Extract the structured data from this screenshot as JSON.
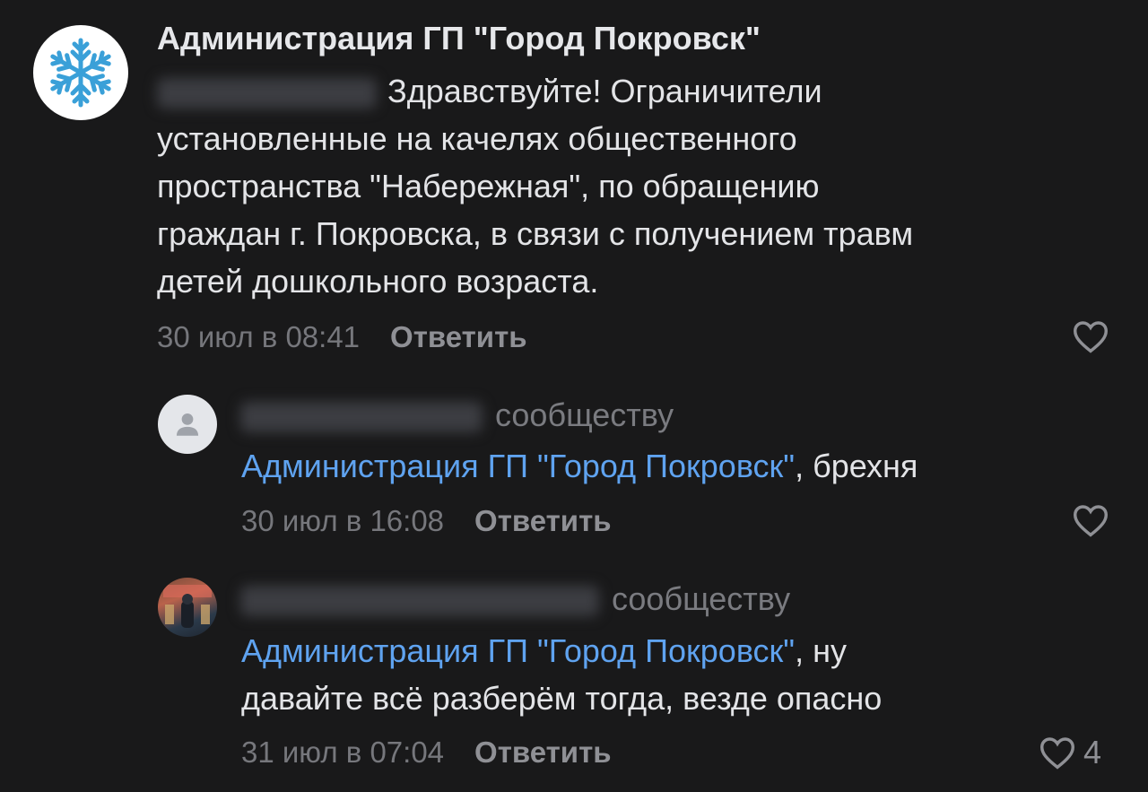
{
  "comments": [
    {
      "author": "Администрация ГП \"Город Покровск\"",
      "text": "Здравствуйте! Ограничители",
      "text_lines": [
        "установленные на качелях общественного",
        "пространства \"Набережная\", по обращению",
        "граждан г. Покровска, в связи с получением травм",
        "детей дошкольного возраста."
      ],
      "time": "30 июл в 08:41",
      "reply_label": "Ответить",
      "avatar_icon": "snowflake-icon"
    },
    {
      "addressee": "сообществу",
      "mention": "Администрация ГП \"Город Покровск\"",
      "text": ", брехня",
      "time": "30 июл в 16:08",
      "reply_label": "Ответить",
      "avatar_icon": "user-placeholder-icon"
    },
    {
      "addressee": "сообществу",
      "mention": "Администрация ГП \"Город Покровск\"",
      "text": ", ну",
      "text_line2": "давайте всё разберём тогда, везде опасно",
      "time": "31 июл в 07:04",
      "reply_label": "Ответить",
      "likes": "4"
    }
  ],
  "colors": {
    "background": "#19191a",
    "link": "#5fa3f0",
    "muted": "#76777c"
  }
}
